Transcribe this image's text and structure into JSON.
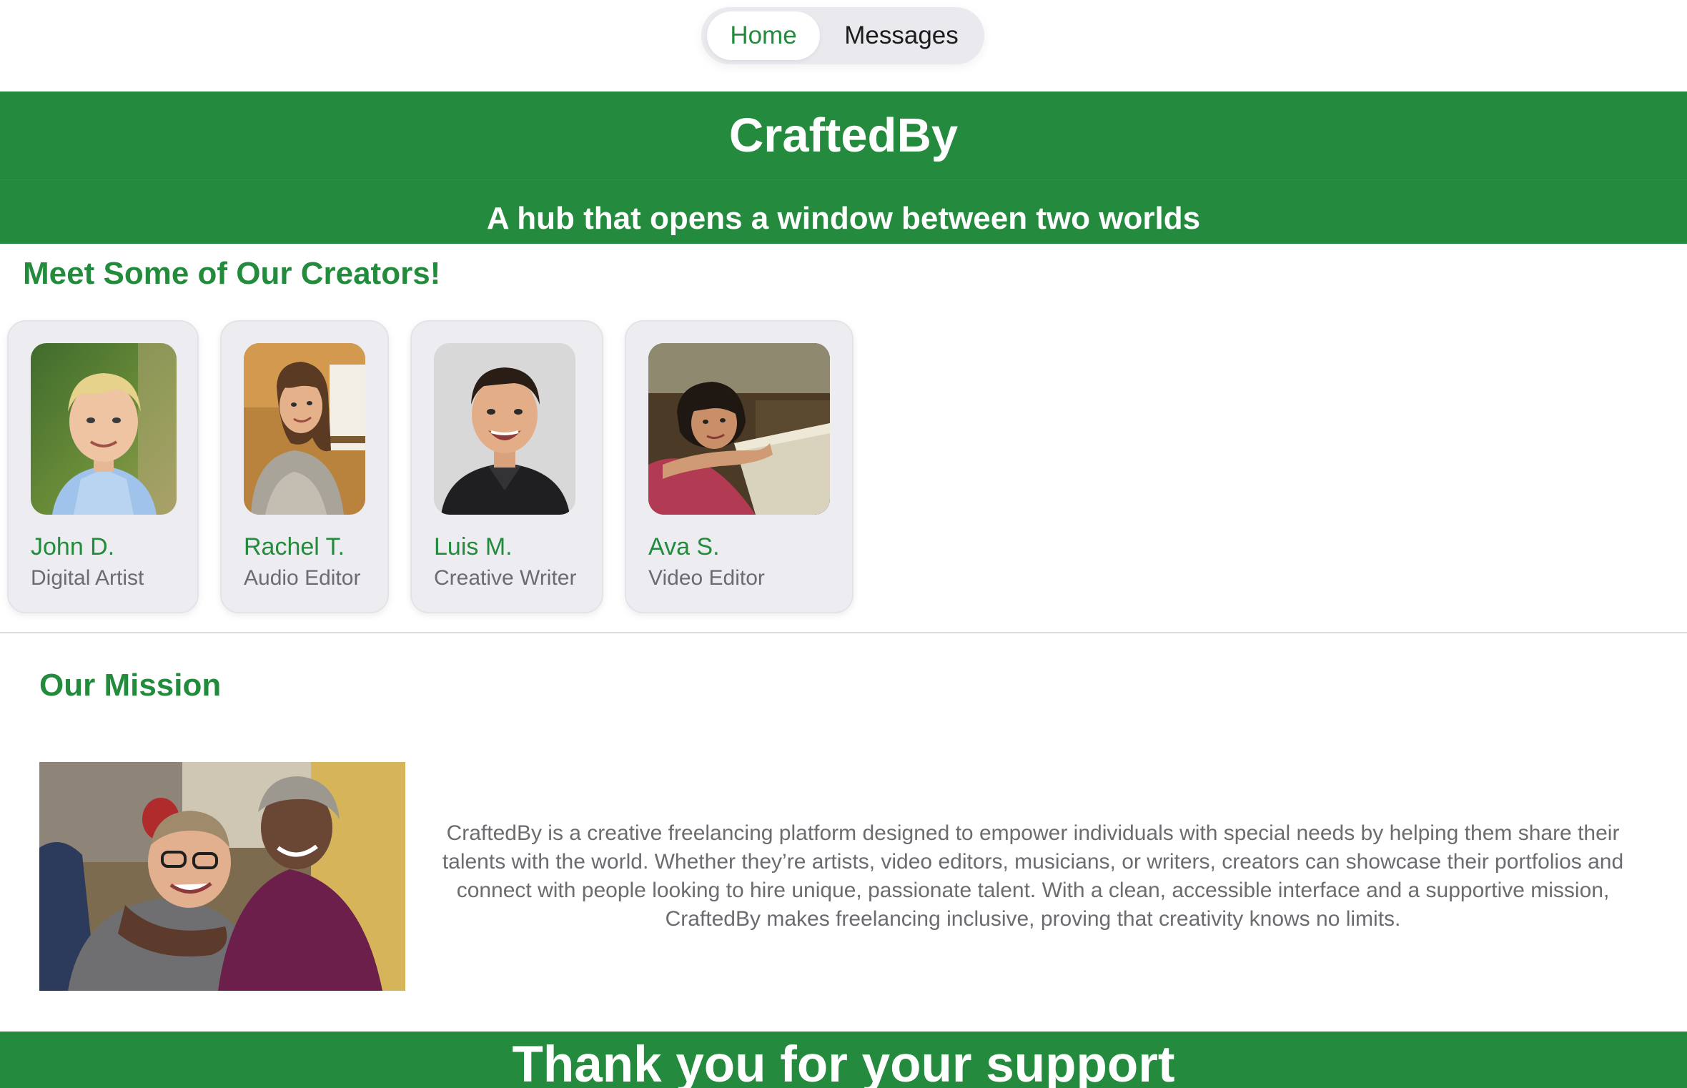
{
  "nav": {
    "home_label": "Home",
    "messages_label": "Messages",
    "active": "Home"
  },
  "banner": {
    "title": "CraftedBy",
    "subtitle": "A hub that opens a window between two worlds"
  },
  "creators": {
    "heading": "Meet Some of Our Creators!",
    "items": [
      {
        "name": "John D.",
        "role": "Digital Artist"
      },
      {
        "name": "Rachel T.",
        "role": "Audio Editor"
      },
      {
        "name": "Luis M.",
        "role": "Creative Writer"
      },
      {
        "name": "Ava S.",
        "role": "Video Editor"
      }
    ]
  },
  "mission": {
    "heading": "Our Mission",
    "body": "CraftedBy is a creative freelancing platform designed to empower individuals with special needs by helping them share their talents with the world. Whether they’re artists, video editors, musicians, or writers, creators can showcase their portfolios and connect with people looking to hire unique, passionate talent. With a clean, accessible interface and a supportive mission, CraftedBy makes freelancing inclusive, proving that creativity knows no limits."
  },
  "footer": {
    "text": "Thank you for your support"
  },
  "colors": {
    "brand_green": "#248a3d",
    "heading_green": "#228b3c",
    "card_bg": "#ececf1",
    "muted_text": "#6b6b70"
  }
}
